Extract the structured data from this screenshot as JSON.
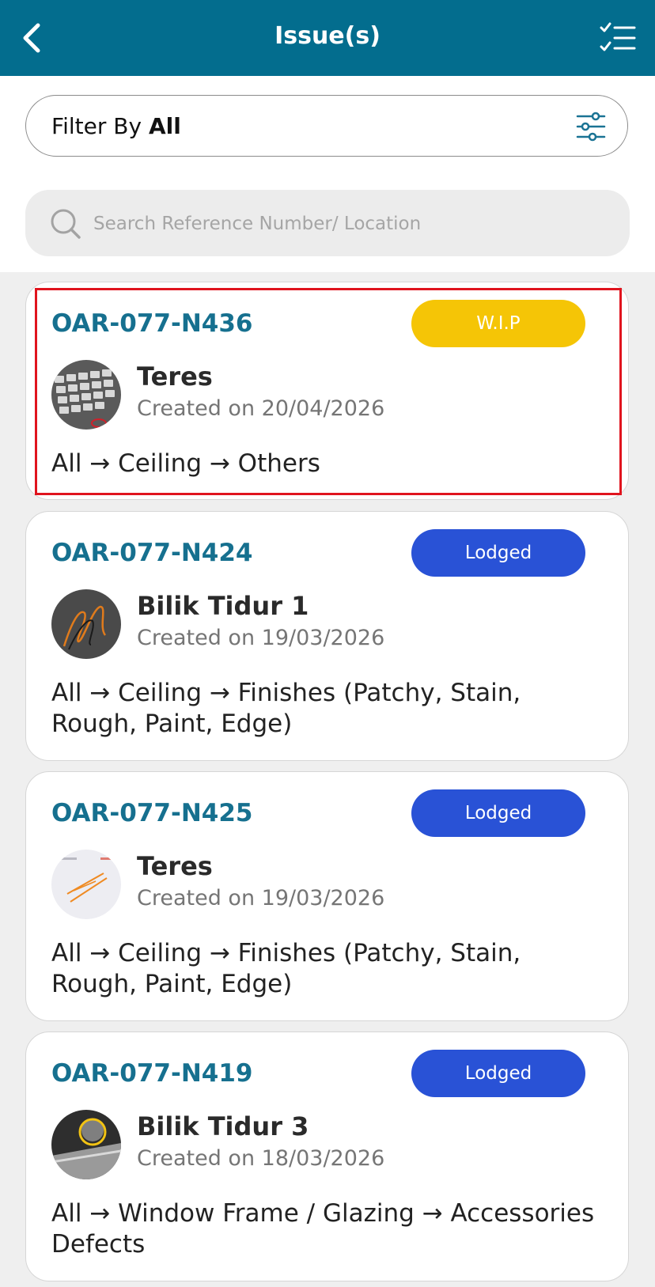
{
  "header": {
    "title": "Issue(s)"
  },
  "filter": {
    "prefix": "Filter By ",
    "value": "All"
  },
  "search": {
    "placeholder": "Search Reference Number/ Location"
  },
  "issues": [
    {
      "ref": "OAR-077-N436",
      "status": "W.I.P",
      "location": "Teres",
      "created": "Created on 20/04/2026",
      "path": "All → Ceiling → Others"
    },
    {
      "ref": "OAR-077-N424",
      "status": "Lodged",
      "location": "Bilik Tidur 1",
      "created": "Created on 19/03/2026",
      "path": "All → Ceiling → Finishes (Patchy, Stain, Rough, Paint, Edge)"
    },
    {
      "ref": "OAR-077-N425",
      "status": "Lodged",
      "location": "Teres",
      "created": "Created on 19/03/2026",
      "path": "All → Ceiling → Finishes (Patchy, Stain, Rough, Paint, Edge)"
    },
    {
      "ref": "OAR-077-N419",
      "status": "Lodged",
      "location": "Bilik Tidur 3",
      "created": "Created on 18/03/2026",
      "path": "All → Window Frame / Glazing → Accessories Defects"
    }
  ],
  "colors": {
    "header_bg": "#036d8e",
    "ref_text": "#16708f",
    "wip": "#f5c506",
    "lodged": "#2952d6",
    "highlight": "#e0141e"
  },
  "icons": {
    "back": "chevron-left-icon",
    "checklist": "checklist-icon",
    "filter": "sliders-icon",
    "search": "search-icon"
  }
}
